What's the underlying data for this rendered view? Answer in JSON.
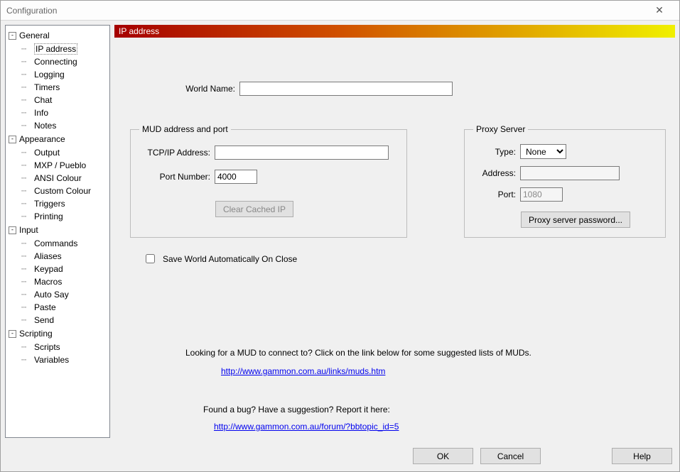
{
  "window": {
    "title": "Configuration"
  },
  "tree": {
    "groups": [
      {
        "name": "General",
        "items": [
          "IP address",
          "Connecting",
          "Logging",
          "Timers",
          "Chat",
          "Info",
          "Notes"
        ]
      },
      {
        "name": "Appearance",
        "items": [
          "Output",
          "MXP / Pueblo",
          "ANSI Colour",
          "Custom Colour",
          "Triggers",
          "Printing"
        ]
      },
      {
        "name": "Input",
        "items": [
          "Commands",
          "Aliases",
          "Keypad",
          "Macros",
          "Auto Say",
          "Paste",
          "Send"
        ]
      },
      {
        "name": "Scripting",
        "items": [
          "Scripts",
          "Variables"
        ]
      }
    ],
    "selected": "IP address"
  },
  "banner": {
    "title": "IP address"
  },
  "world": {
    "label": "World Name:",
    "value": ""
  },
  "mud": {
    "legend": "MUD address and port",
    "address_label": "TCP/IP Address:",
    "address_value": "",
    "port_label": "Port Number:",
    "port_value": "4000",
    "clear_btn": "Clear Cached IP"
  },
  "proxy": {
    "legend": "Proxy Server",
    "type_label": "Type:",
    "type_value": "None",
    "type_options": [
      "None"
    ],
    "address_label": "Address:",
    "address_value": "",
    "port_label": "Port:",
    "port_value": "1080",
    "password_btn": "Proxy server password..."
  },
  "autosave": {
    "label": "Save World Automatically On Close",
    "checked": false
  },
  "info": {
    "mud_prompt": "Looking for a MUD to connect to? Click on the link below for some suggested lists of MUDs.",
    "mud_link": "http://www.gammon.com.au/links/muds.htm",
    "bug_prompt": "Found a bug? Have a suggestion? Report it here:",
    "bug_link": "http://www.gammon.com.au/forum/?bbtopic_id=5"
  },
  "buttons": {
    "ok": "OK",
    "cancel": "Cancel",
    "help": "Help"
  }
}
